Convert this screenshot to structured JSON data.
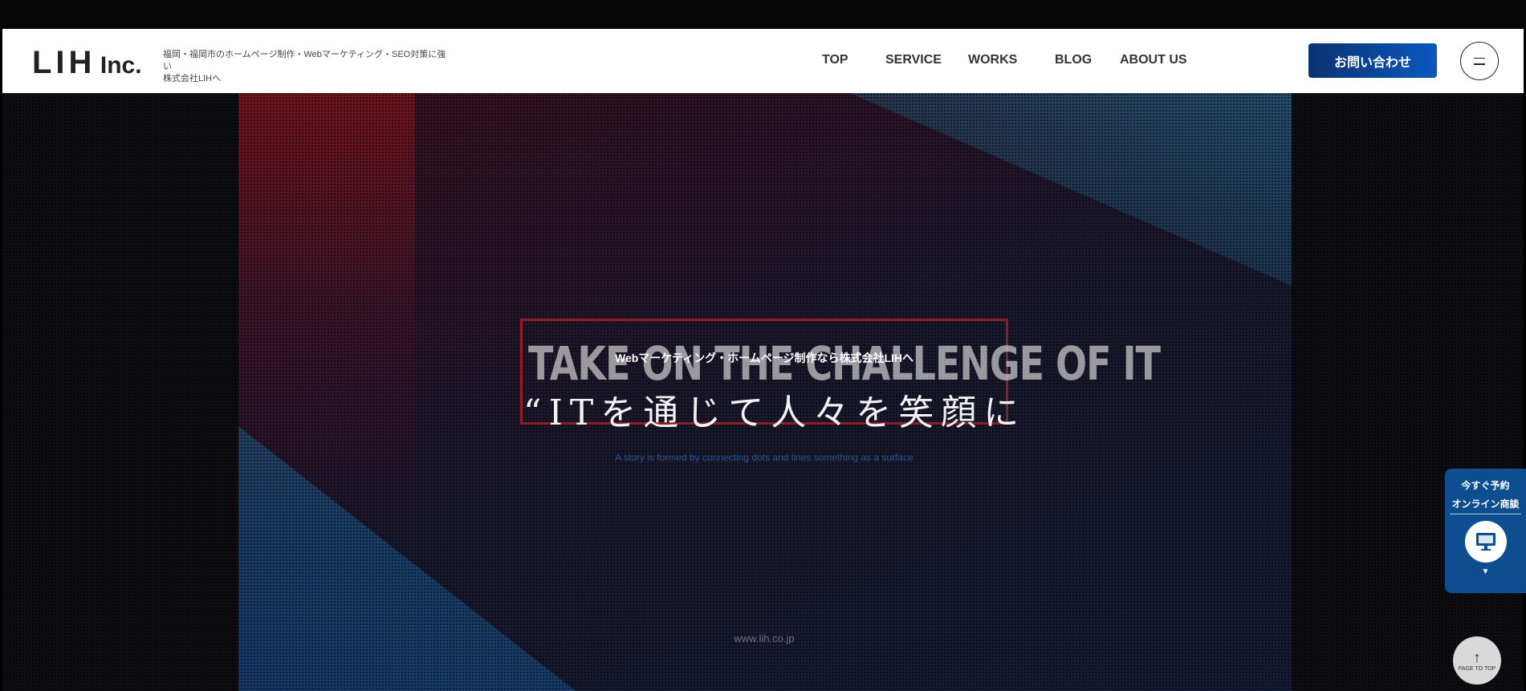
{
  "header": {
    "logo_main": "LIH",
    "logo_suffix": "Inc.",
    "tagline_line1": "福岡・福岡市のホームページ制作・Webマーケティング・SEO対策に強い",
    "tagline_line2": "株式会社LIHへ",
    "nav": [
      {
        "label": "TOP"
      },
      {
        "label": "SERVICE"
      },
      {
        "label": "WORKS"
      },
      {
        "label": "BLOG"
      },
      {
        "label": "ABOUT US"
      }
    ],
    "contact_label": "お問い合わせ"
  },
  "hero": {
    "bg_slogan": "TAKE ON THE CHALLENGE OF IT",
    "subtitle": "Webマーケティング・ホームページ制作なら株式会社LIHへ",
    "heading": "“ITを通じて人々を笑顔に",
    "caption": "A story is formed by connecting dots and lines something as a surface",
    "url": "www.lih.co.jp"
  },
  "side_widget": {
    "line1": "今すぐ予約",
    "line2": "オンライン商談",
    "icon": "monitor-icon",
    "caret": "▼"
  },
  "page_top": {
    "arrow": "↑",
    "label": "PAGE TO TOP"
  },
  "colors": {
    "brand_blue": "#0a58c0",
    "brand_navy": "#0b3270",
    "frame_red": "#8d1e24",
    "widget_blue": "#0c4e8f"
  }
}
